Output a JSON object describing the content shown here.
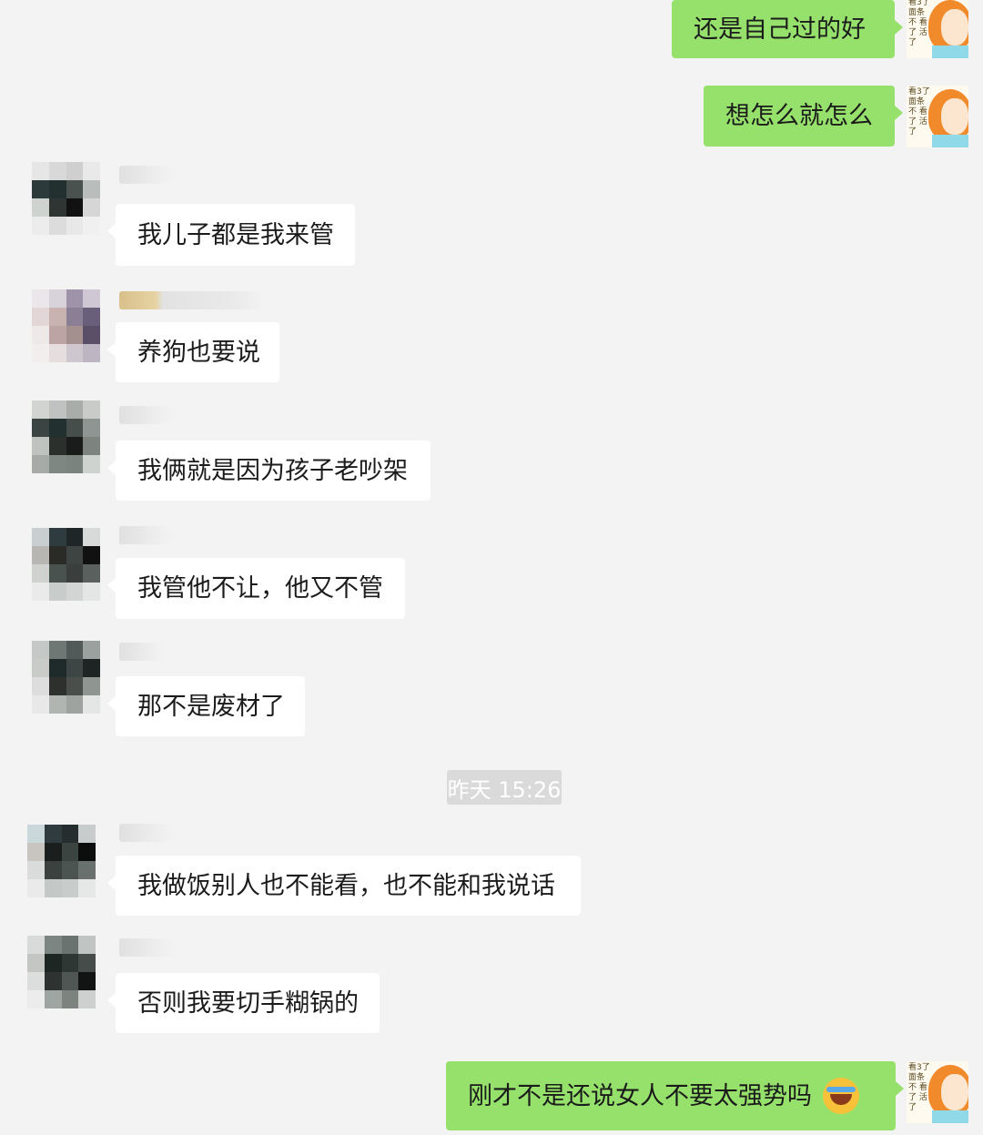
{
  "chat": {
    "outgoing": [
      {
        "text": "还是自己过的好"
      },
      {
        "text": "想怎么就怎么"
      },
      {
        "text": "刚才不是还说女人不要太强势吗"
      }
    ],
    "incoming": [
      {
        "text": "我儿子都是我来管"
      },
      {
        "text": "养狗也要说"
      },
      {
        "text": "我俩就是因为孩子老吵架"
      },
      {
        "text": "我管他不让，他又不管"
      },
      {
        "text": "那不是废材了"
      },
      {
        "text": "我做饭别人也不能看，也不能和我说话"
      },
      {
        "text": "否则我要切手糊锅的"
      }
    ],
    "timestamp": "昨天 15:26",
    "my_avatar_scribble": "看3了 面条不 看了 活了",
    "icons": {
      "my_avatar": "cartoon-girl-avatar-icon",
      "emoji": "laughing-crying-face-emoji-icon"
    },
    "colors": {
      "background": "#f3f3f3",
      "outgoing_bubble": "#95e16b",
      "incoming_bubble": "#ffffff",
      "timestamp_bg": "#dadada"
    }
  }
}
